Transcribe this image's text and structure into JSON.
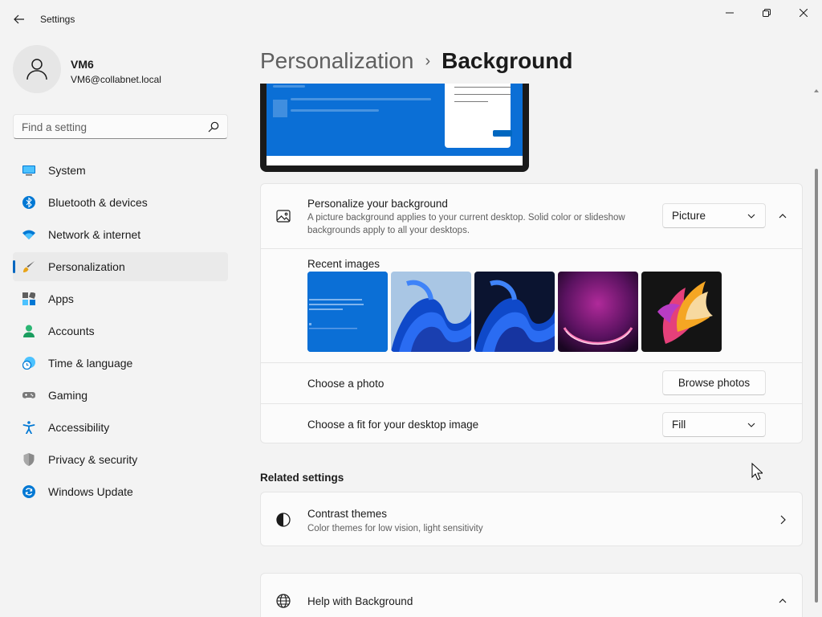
{
  "window": {
    "title": "Settings"
  },
  "profile": {
    "name": "VM6",
    "email": "VM6@collabnet.local"
  },
  "search": {
    "placeholder": "Find a setting"
  },
  "sidebar": {
    "items": [
      {
        "label": "System",
        "icon": "system-icon",
        "active": false
      },
      {
        "label": "Bluetooth & devices",
        "icon": "bluetooth-icon",
        "active": false
      },
      {
        "label": "Network & internet",
        "icon": "wifi-icon",
        "active": false
      },
      {
        "label": "Personalization",
        "icon": "brush-icon",
        "active": true
      },
      {
        "label": "Apps",
        "icon": "apps-icon",
        "active": false
      },
      {
        "label": "Accounts",
        "icon": "person-icon",
        "active": false
      },
      {
        "label": "Time & language",
        "icon": "globe-clock-icon",
        "active": false
      },
      {
        "label": "Gaming",
        "icon": "gamepad-icon",
        "active": false
      },
      {
        "label": "Accessibility",
        "icon": "accessibility-icon",
        "active": false
      },
      {
        "label": "Privacy & security",
        "icon": "shield-icon",
        "active": false
      },
      {
        "label": "Windows Update",
        "icon": "update-icon",
        "active": false
      }
    ]
  },
  "breadcrumb": {
    "parent": "Personalization",
    "separator": "›",
    "current": "Background"
  },
  "background_card": {
    "title": "Personalize your background",
    "description": "A picture background applies to your current desktop. Solid color or slideshow backgrounds apply to all your desktops.",
    "type_value": "Picture",
    "recent_images_label": "Recent images",
    "choose_photo_label": "Choose a photo",
    "browse_button": "Browse photos",
    "fit_label": "Choose a fit for your desktop image",
    "fit_value": "Fill"
  },
  "related": {
    "heading": "Related settings",
    "contrast_title": "Contrast themes",
    "contrast_desc": "Color themes for low vision, light sensitivity"
  },
  "help": {
    "title": "Help with Background"
  },
  "colors": {
    "accent": "#0067c0",
    "background": "#f3f3f3",
    "card": "#fbfbfb"
  }
}
